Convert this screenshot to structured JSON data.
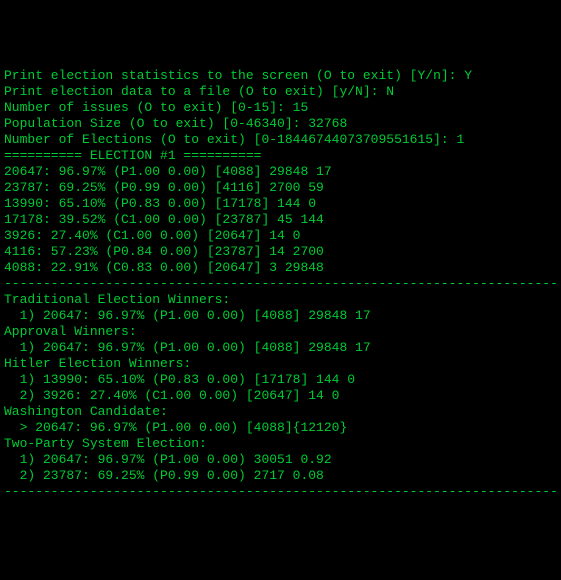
{
  "lines": [
    "Print election statistics to the screen (O to exit) [Y/n]: Y",
    "Print election data to a file (O to exit) [y/N]: N",
    "Number of issues (O to exit) [0-15]: 15",
    "Population Size (O to exit) [0-46340]: 32768",
    "Number of Elections (O to exit) [0-18446744073709551615]: 1",
    "",
    "========== ELECTION #1 ==========",
    "20647: 96.97% (P1.00 0.00) [4088] 29848 17",
    "23787: 69.25% (P0.99 0.00) [4116] 2700 59",
    "13990: 65.10% (P0.83 0.00) [17178] 144 0",
    "17178: 39.52% (C1.00 0.00) [23787] 45 144",
    "3926: 27.40% (C1.00 0.00) [20647] 14 0",
    "4116: 57.23% (P0.84 0.00) [23787] 14 2700",
    "4088: 22.91% (C0.83 0.00) [20647] 3 29848",
    "",
    "-----------------------------------------------------------------------",
    "",
    "Traditional Election Winners:",
    "  1) 20647: 96.97% (P1.00 0.00) [4088] 29848 17",
    "",
    "Approval Winners:",
    "  1) 20647: 96.97% (P1.00 0.00) [4088] 29848 17",
    "",
    "Hitler Election Winners:",
    "  1) 13990: 65.10% (P0.83 0.00) [17178] 144 0",
    "  2) 3926: 27.40% (C1.00 0.00) [20647] 14 0",
    "",
    "Washington Candidate:",
    "  > 20647: 96.97% (P1.00 0.00) [4088]{12120}",
    "",
    "Two-Party System Election:",
    "  1) 20647: 96.97% (P1.00 0.00) 30051 0.92",
    "  2) 23787: 69.25% (P0.99 0.00) 2717 0.08",
    "",
    "-----------------------------------------------------------------------"
  ]
}
